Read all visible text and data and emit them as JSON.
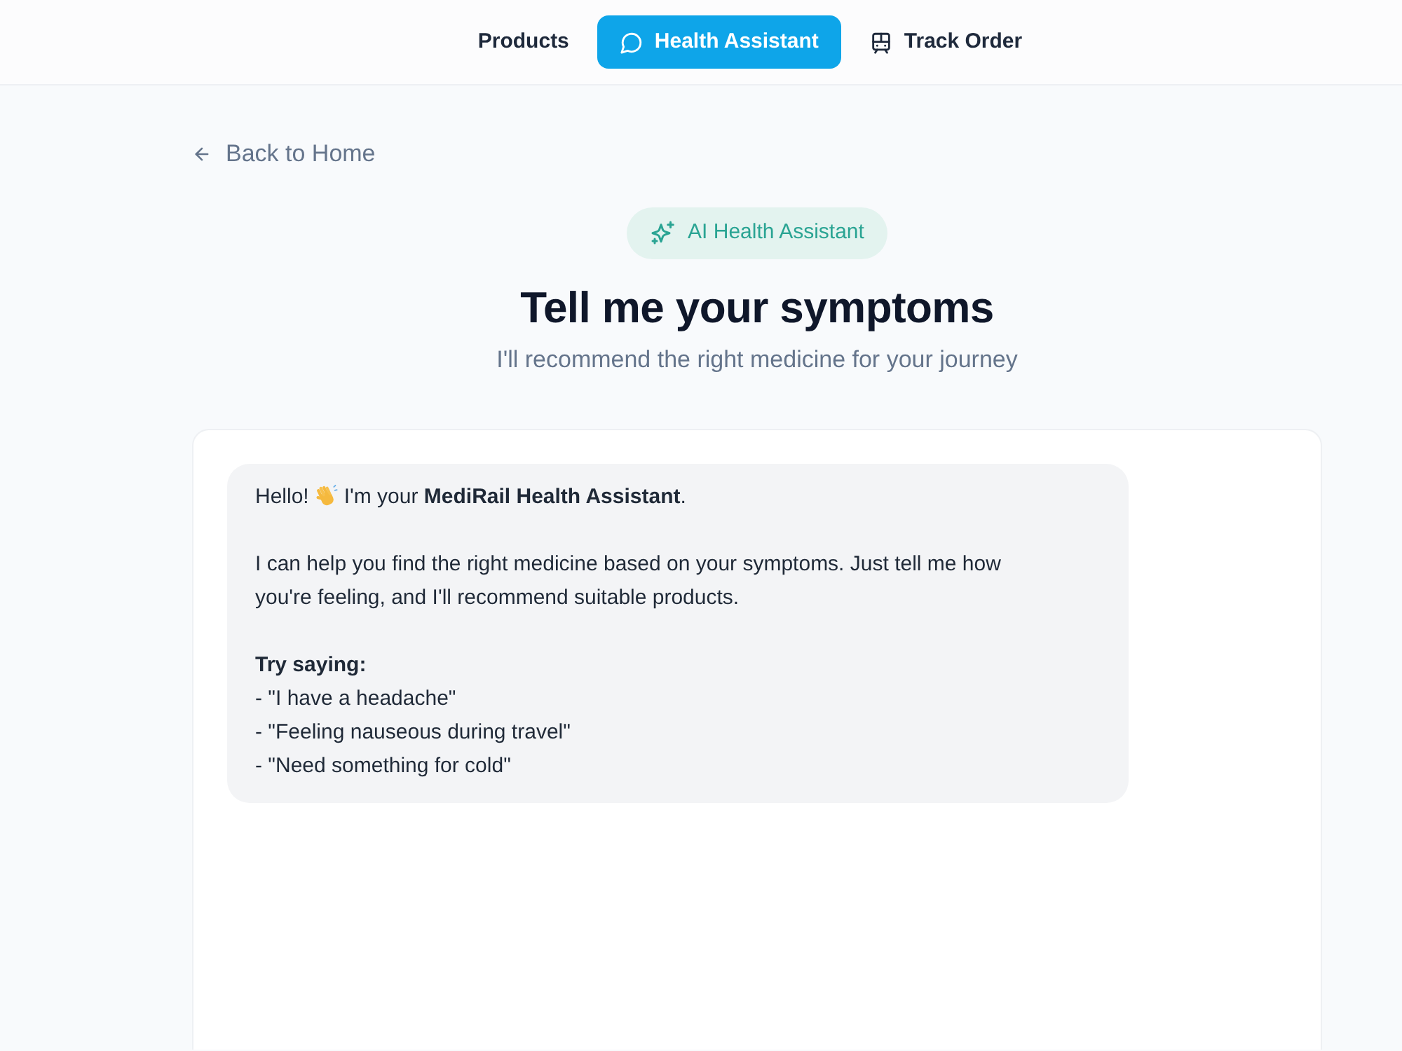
{
  "nav": {
    "items": [
      {
        "label": "Products",
        "selected": false
      },
      {
        "label": "Health Assistant",
        "selected": true
      },
      {
        "label": "Track Order",
        "selected": false
      }
    ]
  },
  "back_link": "Back to Home",
  "badge": "AI Health Assistant",
  "title": "Tell me your symptoms",
  "subtitle": "I'll recommend the right medicine for your journey",
  "chat": {
    "messages": [
      {
        "greeting": "Hello!",
        "intro": "I'm your **MediRail Health Assistant**.",
        "paragraph": "I can help you find the right medicine based on your symptoms. Just tell me how you're feeling, and I'll recommend suitable products.",
        "examples_title": "Try saying:",
        "examples": [
          "- \"I have a headache\"",
          "- \"Feeling nauseous during travel\"",
          "- \"Need something for cold\""
        ]
      }
    ]
  }
}
